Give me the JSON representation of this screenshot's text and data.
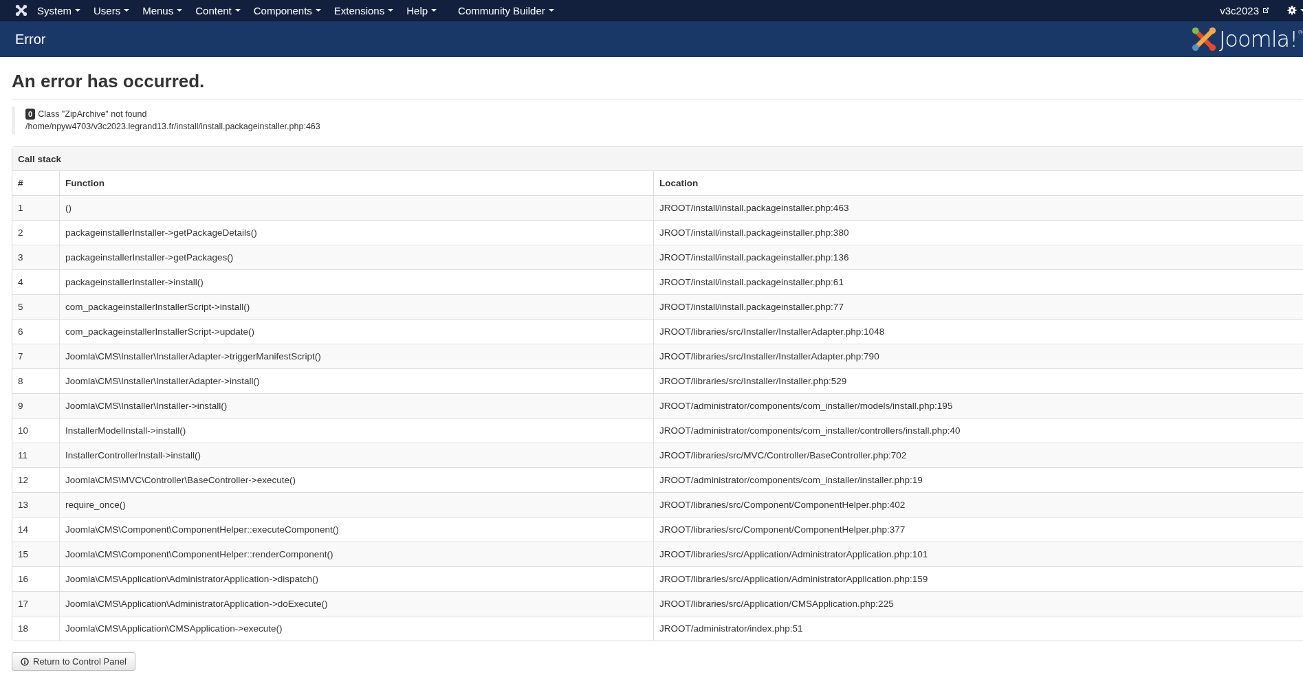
{
  "navbar": {
    "menus": [
      "System",
      "Users",
      "Menus",
      "Content",
      "Components",
      "Extensions",
      "Help",
      "Community Builder"
    ],
    "site_link": "v3c2023"
  },
  "header": {
    "title": "Error",
    "logo_text": "Joomla!",
    "logo_mark": "®"
  },
  "error": {
    "heading": "An error has occurred.",
    "code": "0",
    "message": "Class \"ZipArchive\" not found",
    "file": "/home/npyw4703/v3c2023.legrand13.fr/install/install.packageinstaller.php:463"
  },
  "call_stack": {
    "caption": "Call stack",
    "columns": [
      "#",
      "Function",
      "Location"
    ],
    "rows": [
      {
        "num": "1",
        "function": "()",
        "location": "JROOT/install/install.packageinstaller.php:463"
      },
      {
        "num": "2",
        "function": "packageinstallerInstaller->getPackageDetails()",
        "location": "JROOT/install/install.packageinstaller.php:380"
      },
      {
        "num": "3",
        "function": "packageinstallerInstaller->getPackages()",
        "location": "JROOT/install/install.packageinstaller.php:136"
      },
      {
        "num": "4",
        "function": "packageinstallerInstaller->install()",
        "location": "JROOT/install/install.packageinstaller.php:61"
      },
      {
        "num": "5",
        "function": "com_packageinstallerInstallerScript->install()",
        "location": "JROOT/install/install.packageinstaller.php:77"
      },
      {
        "num": "6",
        "function": "com_packageinstallerInstallerScript->update()",
        "location": "JROOT/libraries/src/Installer/InstallerAdapter.php:1048"
      },
      {
        "num": "7",
        "function": "Joomla\\CMS\\Installer\\InstallerAdapter->triggerManifestScript()",
        "location": "JROOT/libraries/src/Installer/InstallerAdapter.php:790"
      },
      {
        "num": "8",
        "function": "Joomla\\CMS\\Installer\\InstallerAdapter->install()",
        "location": "JROOT/libraries/src/Installer/Installer.php:529"
      },
      {
        "num": "9",
        "function": "Joomla\\CMS\\Installer\\Installer->install()",
        "location": "JROOT/administrator/components/com_installer/models/install.php:195"
      },
      {
        "num": "10",
        "function": "InstallerModelInstall->install()",
        "location": "JROOT/administrator/components/com_installer/controllers/install.php:40"
      },
      {
        "num": "11",
        "function": "InstallerControllerInstall->install()",
        "location": "JROOT/libraries/src/MVC/Controller/BaseController.php:702"
      },
      {
        "num": "12",
        "function": "Joomla\\CMS\\MVC\\Controller\\BaseController->execute()",
        "location": "JROOT/administrator/components/com_installer/installer.php:19"
      },
      {
        "num": "13",
        "function": "require_once()",
        "location": "JROOT/libraries/src/Component/ComponentHelper.php:402"
      },
      {
        "num": "14",
        "function": "Joomla\\CMS\\Component\\ComponentHelper::executeComponent()",
        "location": "JROOT/libraries/src/Component/ComponentHelper.php:377"
      },
      {
        "num": "15",
        "function": "Joomla\\CMS\\Component\\ComponentHelper::renderComponent()",
        "location": "JROOT/libraries/src/Application/AdministratorApplication.php:101"
      },
      {
        "num": "16",
        "function": "Joomla\\CMS\\Application\\AdministratorApplication->dispatch()",
        "location": "JROOT/libraries/src/Application/AdministratorApplication.php:159"
      },
      {
        "num": "17",
        "function": "Joomla\\CMS\\Application\\AdministratorApplication->doExecute()",
        "location": "JROOT/libraries/src/Application/CMSApplication.php:225"
      },
      {
        "num": "18",
        "function": "Joomla\\CMS\\Application\\CMSApplication->execute()",
        "location": "JROOT/administrator/index.php:51"
      }
    ]
  },
  "return_button": "Return to Control Panel"
}
